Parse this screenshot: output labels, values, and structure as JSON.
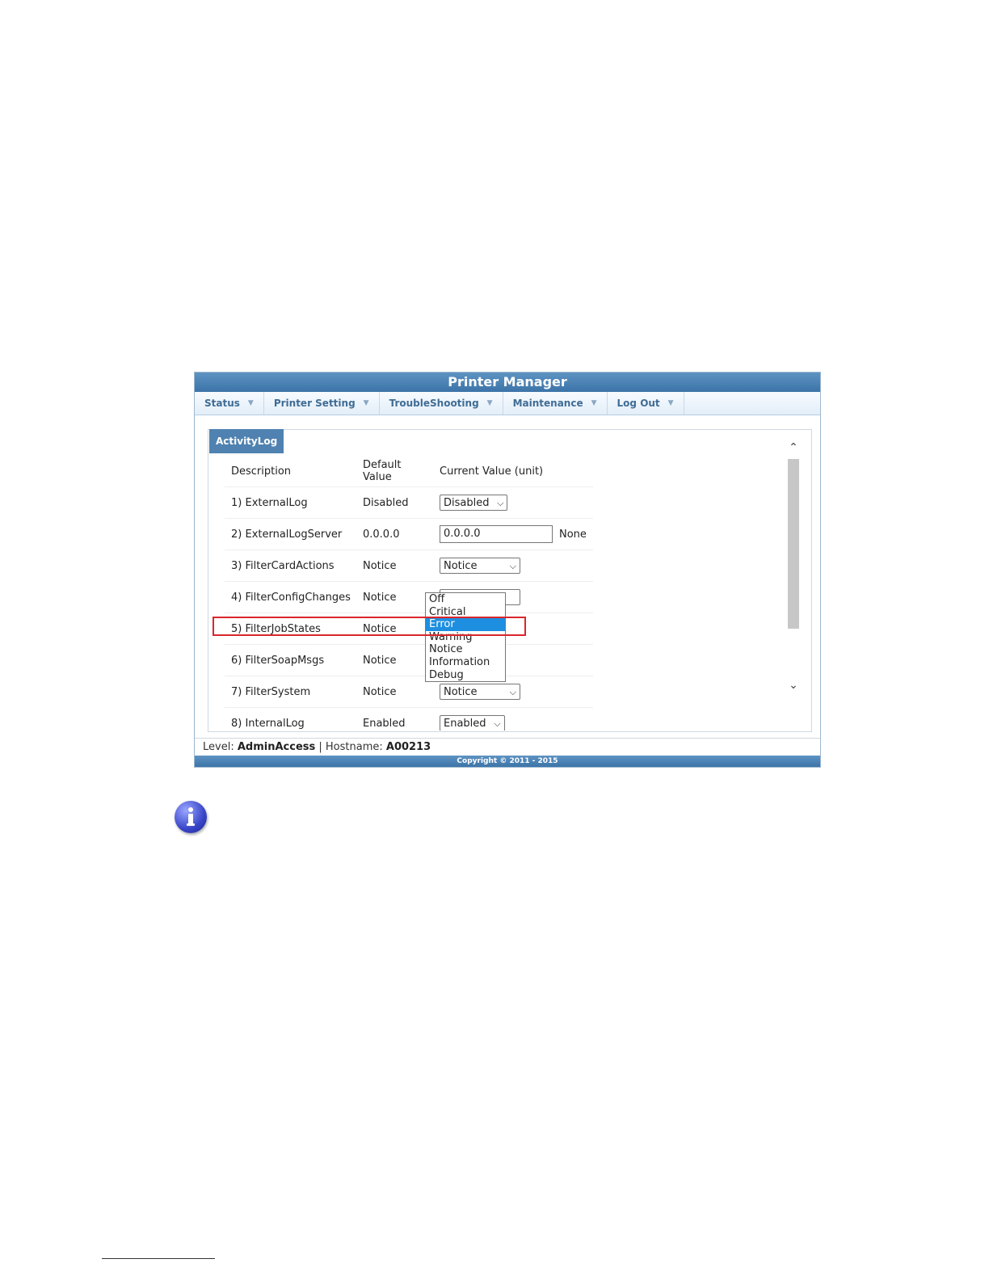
{
  "app": {
    "title": "Printer Manager",
    "menu": [
      {
        "label": "Status"
      },
      {
        "label": "Printer Setting"
      },
      {
        "label": "TroubleShooting"
      },
      {
        "label": "Maintenance"
      },
      {
        "label": "Log Out"
      }
    ],
    "tab_label": "ActivityLog",
    "table": {
      "headers": [
        "Description",
        "Default Value",
        "Current Value (unit)"
      ],
      "rows": [
        {
          "desc": "1) ExternalLog",
          "default": "Disabled",
          "current": "Disabled",
          "control": "select"
        },
        {
          "desc": "2) ExternalLogServer",
          "default": "0.0.0.0",
          "current": "0.0.0.0",
          "control": "text",
          "unit": "None"
        },
        {
          "desc": "3) FilterCardActions",
          "default": "Notice",
          "current": "Notice",
          "control": "select"
        },
        {
          "desc": "4) FilterConfigChanges",
          "default": "Notice",
          "current": "",
          "control": "select-open"
        },
        {
          "desc": "5) FilterJobStates",
          "default": "Notice",
          "current": "",
          "control": "none"
        },
        {
          "desc": "6) FilterSoapMsgs",
          "default": "Notice",
          "current": "",
          "control": "none"
        },
        {
          "desc": "7) FilterSystem",
          "default": "Notice",
          "current": "Notice",
          "control": "select"
        },
        {
          "desc": "8) InternalLog",
          "default": "Enabled",
          "current": "Enabled",
          "control": "select"
        }
      ]
    },
    "dropdown_options": [
      "Off",
      "Critical",
      "Error",
      "Warning",
      "Notice",
      "Information",
      "Debug"
    ],
    "dropdown_selected": "Error",
    "status_bar": {
      "level_label": "Level:",
      "level_value": "AdminAccess",
      "separator": "|",
      "hostname_label": "Hostname:",
      "hostname_value": "A00213"
    },
    "footer": "Copyright © 2011 - 2015"
  },
  "colors": {
    "header_blue": "#3c74a8",
    "highlight_red": "#d9262c",
    "selected_option": "#1e8fe0"
  }
}
